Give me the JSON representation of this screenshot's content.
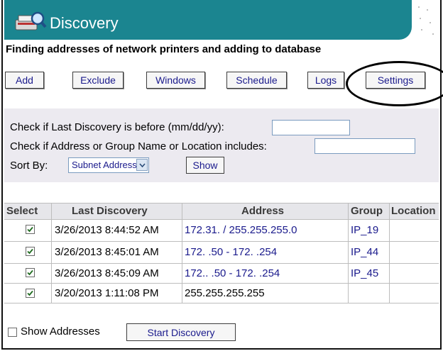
{
  "app": {
    "title": "Discovery",
    "subtitle": "Finding addresses of network printers and adding to database"
  },
  "toolbar": [
    {
      "label": "Add"
    },
    {
      "label": "Exclude"
    },
    {
      "label": "Windows"
    },
    {
      "label": "Schedule"
    },
    {
      "label": "Logs"
    },
    {
      "label": "Settings"
    }
  ],
  "filters": {
    "date_label": "Check if Last Discovery is before (mm/dd/yy):",
    "date_value": "",
    "name_label": "Check if Address or Group Name or Location includes:",
    "name_value": "",
    "sort_label": "Sort By:",
    "sort_value": "Subnet Address",
    "show_label": "Show"
  },
  "table": {
    "headers": [
      "Select",
      "Last Discovery",
      "Address",
      "Group",
      "Location"
    ],
    "rows": [
      {
        "selected": true,
        "last_discovery": "3/26/2013 8:44:52 AM",
        "address": "172.31.      / 255.255.255.0",
        "group": "IP_19",
        "location": ""
      },
      {
        "selected": true,
        "last_discovery": "3/26/2013 8:45:01 AM",
        "address": "172.        .50 - 172.        .254",
        "group": "IP_44",
        "location": ""
      },
      {
        "selected": true,
        "last_discovery": "3/26/2013 8:45:09 AM",
        "address": "172..    .50 - 172.        .254",
        "group": "IP_45",
        "location": ""
      },
      {
        "selected": true,
        "last_discovery": "3/20/2013 1:11:08 PM",
        "address": "255.255.255.255",
        "group": "",
        "location": ""
      }
    ]
  },
  "footer": {
    "show_addresses_label": "Show Addresses",
    "show_addresses_checked": false,
    "start_label": "Start Discovery"
  },
  "colors": {
    "header_bg": "#1b8590",
    "link_blue": "#1a1a8c",
    "panel_bg": "#eceaf0"
  }
}
